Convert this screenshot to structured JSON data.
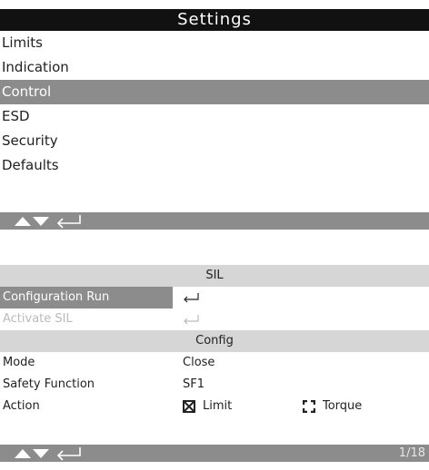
{
  "settings": {
    "title": "Settings",
    "items": [
      {
        "label": "Limits",
        "selected": false
      },
      {
        "label": "Indication",
        "selected": false
      },
      {
        "label": "Control",
        "selected": true
      },
      {
        "label": "ESD",
        "selected": false
      },
      {
        "label": "Security",
        "selected": false
      },
      {
        "label": "Defaults",
        "selected": false
      }
    ],
    "footer_icons": [
      "up-arrow-icon",
      "down-arrow-icon",
      "enter-icon"
    ]
  },
  "sil": {
    "title": "SIL",
    "rows": [
      {
        "label": "Configuration Run",
        "value_icon": "enter-icon",
        "selected": true,
        "disabled": false
      },
      {
        "label": "Activate SIL",
        "value_icon": "enter-icon",
        "selected": false,
        "disabled": true
      }
    ],
    "config_header": "Config",
    "mode": {
      "label": "Mode",
      "value": "Close"
    },
    "safety_function": {
      "label": "Safety Function",
      "value": "SF1"
    },
    "action": {
      "label": "Action",
      "options": [
        {
          "label": "Limit",
          "checked": true
        },
        {
          "label": "Torque",
          "checked": false
        }
      ]
    },
    "footer_icons": [
      "up-arrow-icon",
      "down-arrow-icon",
      "enter-icon"
    ],
    "page_counter": "1/18"
  },
  "colors": {
    "title_bar": "#111111",
    "highlight": "#8c8c8c",
    "section_header": "#d6d6d6",
    "disabled_text": "#bbbbbb"
  }
}
